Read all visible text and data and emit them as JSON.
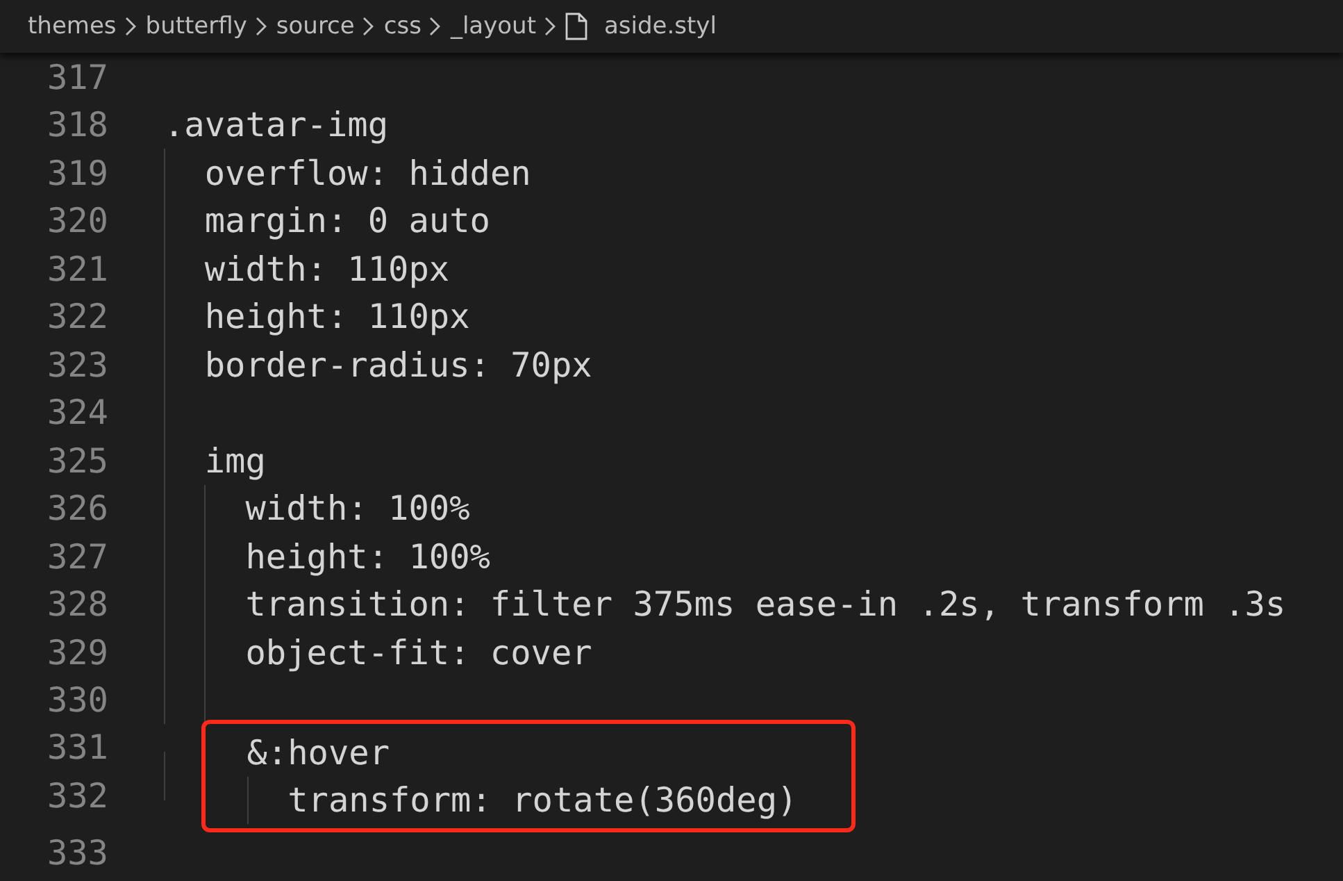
{
  "breadcrumb": {
    "folders": [
      "themes",
      "butterfly",
      "source",
      "css",
      "_layout"
    ],
    "file": "aside.styl"
  },
  "lines": [
    {
      "number": "317",
      "highlighted": false
    },
    {
      "number": "318",
      "text": ".avatar-img",
      "highlighted": false,
      "children": [
        {
          "number": "319",
          "text": "overflow: hidden",
          "highlighted": false
        },
        {
          "number": "320",
          "text": "margin: 0 auto",
          "highlighted": false
        },
        {
          "number": "321",
          "text": "width: 110px",
          "highlighted": false
        },
        {
          "number": "322",
          "text": "height: 110px",
          "highlighted": false
        },
        {
          "number": "323",
          "text": "border-radius: 70px",
          "highlighted": false
        },
        {
          "number": "324",
          "highlighted": false
        },
        {
          "number": "325",
          "text": "img",
          "highlighted": false,
          "children": [
            {
              "number": "326",
              "text": "width: 100%",
              "highlighted": false
            },
            {
              "number": "327",
              "text": "height: 100%",
              "highlighted": false
            },
            {
              "number": "328",
              "text": "transition: filter 375ms ease-in .2s, transform .3s",
              "highlighted": false
            },
            {
              "number": "329",
              "text": "object-fit: cover",
              "highlighted": false
            },
            {
              "number": "330",
              "highlighted": false
            },
            {
              "number": "331",
              "text": "&:hover",
              "highlighted": true,
              "children": [
                {
                  "number": "332",
                  "text": "transform: rotate(360deg)",
                  "highlighted": true
                }
              ]
            }
          ]
        }
      ]
    },
    {
      "number": "333",
      "highlighted": false
    }
  ]
}
